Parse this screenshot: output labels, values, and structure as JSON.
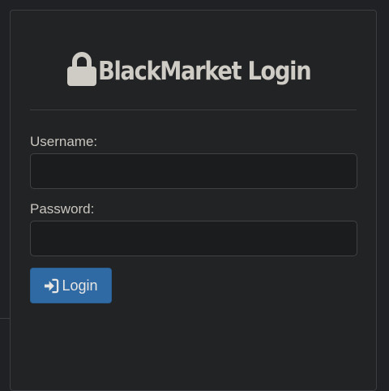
{
  "header": {
    "title": "BlackMarket Login",
    "icon": "lock-icon"
  },
  "form": {
    "username_label": "Username:",
    "username_value": "",
    "password_label": "Password:",
    "password_value": "",
    "login_button_label": "Login",
    "login_button_icon": "sign-in-icon"
  },
  "colors": {
    "background": "#202124",
    "panel": "#222325",
    "accent": "#2f6aa4",
    "text": "#c9c5bf"
  }
}
